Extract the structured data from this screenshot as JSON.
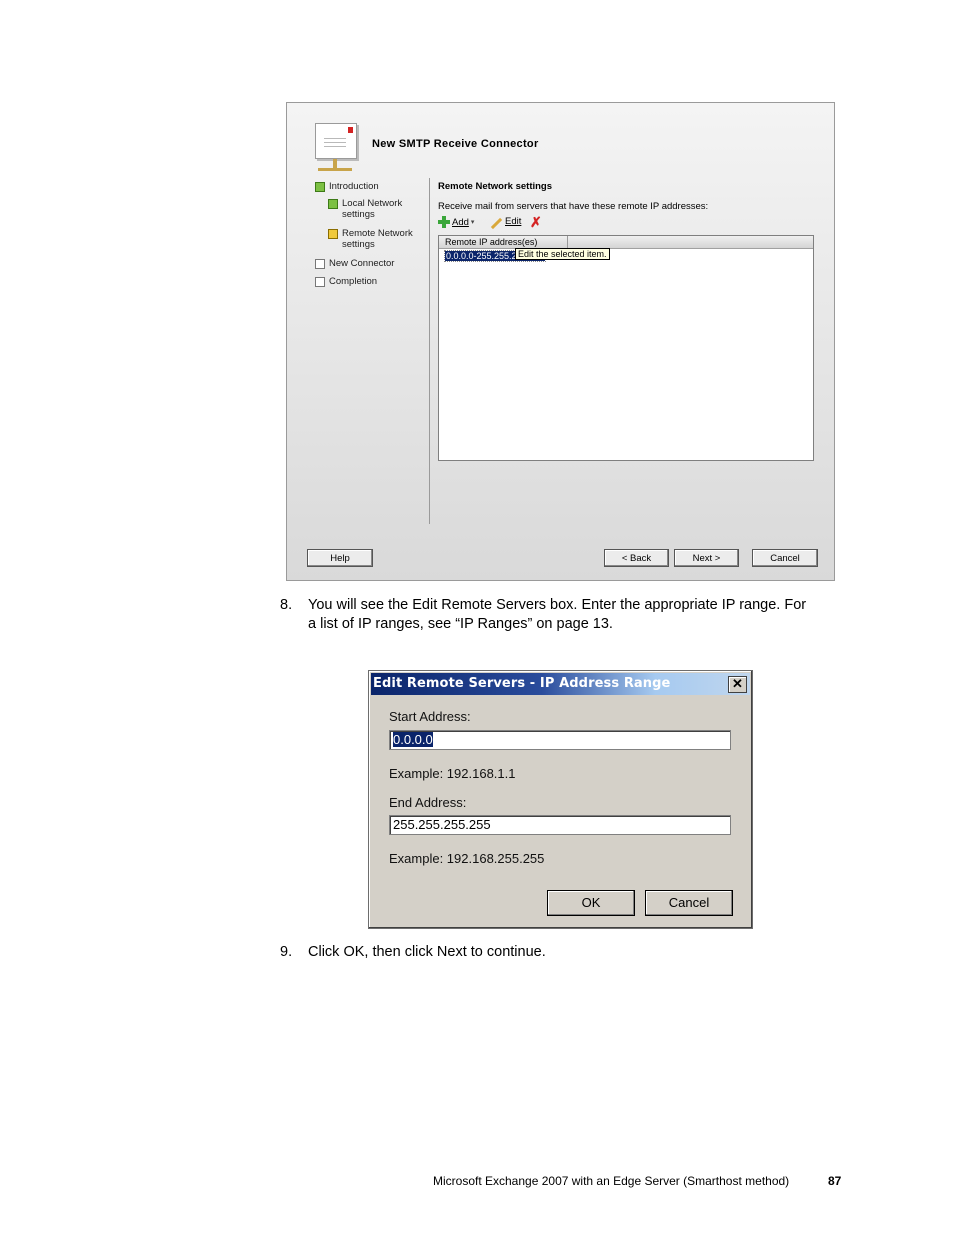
{
  "wizard": {
    "title": "New SMTP Receive Connector",
    "steps": [
      {
        "label": "Introduction",
        "status": "complete"
      },
      {
        "label": "Local Network settings",
        "status": "complete"
      },
      {
        "label": "Remote Network settings",
        "status": "current"
      },
      {
        "label": "New Connector",
        "status": "pending"
      },
      {
        "label": "Completion",
        "status": "pending"
      }
    ],
    "section_title": "Remote Network settings",
    "description": "Receive mail from servers that have these remote IP addresses:",
    "toolbar": {
      "add_label": "Add",
      "edit_label": "Edit"
    },
    "list": {
      "column_header": "Remote IP address(es)",
      "rows": [
        "0.0.0.0-255.255.255.255"
      ],
      "tooltip": "Edit the selected item."
    },
    "buttons": {
      "help": "Help",
      "back": "< Back",
      "next": "Next >",
      "cancel": "Cancel"
    }
  },
  "instructions": {
    "step8_number": "8.",
    "step8_line1": "You will see the Edit Remote Servers box. Enter the appropriate IP range. For",
    "step8_line2": "a list of IP ranges, see “IP Ranges” on page 13.",
    "step9_number": "9.",
    "step9_text": "Click OK, then click Next to continue."
  },
  "dialog": {
    "title": "Edit Remote Servers - IP Address Range",
    "start_label": "Start Address:",
    "start_value": "0.0.0.0",
    "start_example": "Example: 192.168.1.1",
    "end_label": "End Address:",
    "end_value": "255.255.255.255",
    "end_example": "Example: 192.168.255.255",
    "ok_label": "OK",
    "cancel_label": "Cancel"
  },
  "footer": {
    "text": "Microsoft Exchange 2007 with an Edge Server (Smarthost method)",
    "page_number": "87"
  }
}
